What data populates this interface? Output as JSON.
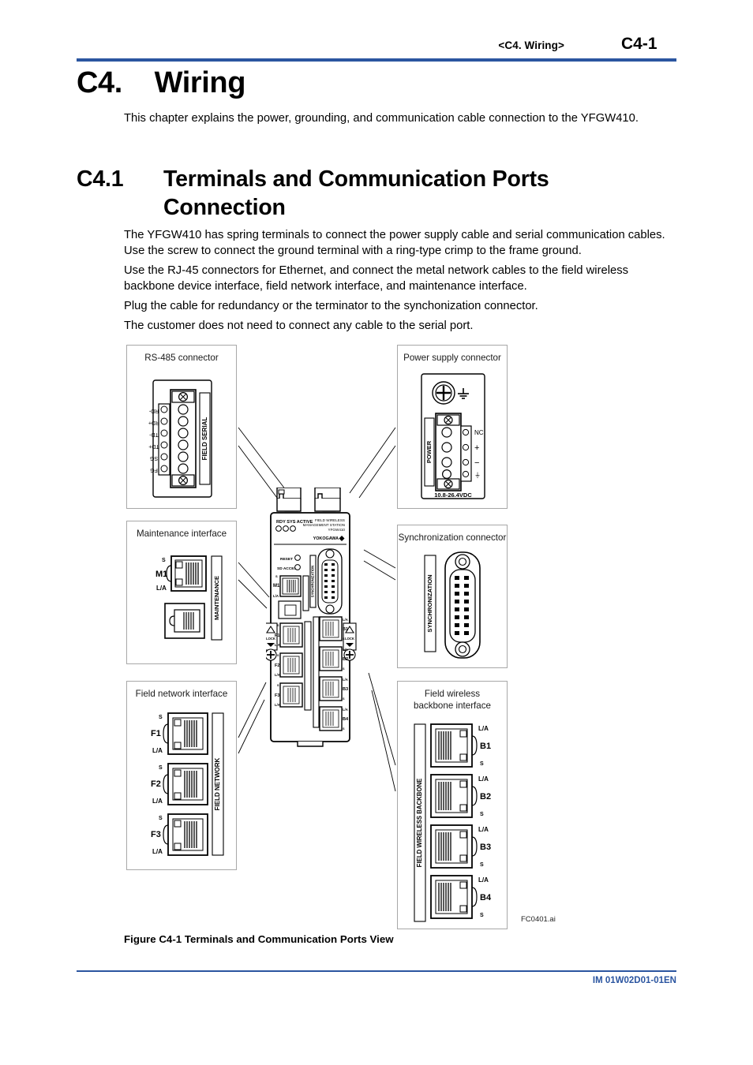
{
  "header": {
    "chapter_ref": "<C4.  Wiring>",
    "page_number": "C4-1",
    "rule_color": "#2b55a0"
  },
  "chapter": {
    "number": "C4.",
    "title": "Wiring",
    "heading_display": "C4.    Wiring",
    "intro": "This chapter explains the power, grounding, and communication cable connection to the YFGW410."
  },
  "section": {
    "number": "C4.1",
    "title": "Terminals and Communication Ports Connection",
    "paragraphs": [
      "The YFGW410 has spring terminals to connect the power supply cable and serial communication cables. Use the screw to connect the ground terminal with a ring-type crimp to the frame ground.",
      "Use the RJ-45 connectors for Ethernet, and connect the metal network cables to the field wireless backbone device interface, field network interface, and maintenance interface.",
      "Plug the cable for redundancy or the terminator to the synchonization connector.",
      "The customer does not need to connect any cable to the serial port."
    ]
  },
  "figure": {
    "caption": "Figure C4-1  Terminals and Communication Ports View",
    "artwork_ref": "FC0401.ai",
    "callouts": {
      "rs485": {
        "label": "RS-485 connector",
        "side_label": "FIELD SERIAL",
        "terminals": [
          "RD-",
          "RD+",
          "TD-",
          "TD+",
          "SG",
          "FG"
        ]
      },
      "power": {
        "label": "Power supply connector",
        "side_label": "POWER",
        "terminals": [
          "NC",
          "+",
          "−",
          "⏚"
        ],
        "voltage_rating": "10.8-26.4VDC"
      },
      "maintenance": {
        "label": "Maintenance interface",
        "side_label": "MAINTENANCE",
        "ports": [
          {
            "name": "M1",
            "led_top": "S",
            "led_bottom": "L/A"
          }
        ]
      },
      "sync": {
        "label": "Synchronization connector",
        "side_label": "SYNCHRONIZATION"
      },
      "field_network": {
        "label": "Field network interface",
        "side_label": "FIELD NETWORK",
        "ports": [
          {
            "name": "F1",
            "led_top": "S",
            "led_bottom": "L/A"
          },
          {
            "name": "F2",
            "led_top": "S",
            "led_bottom": "L/A"
          },
          {
            "name": "F3",
            "led_top": "S",
            "led_bottom": "L/A"
          }
        ]
      },
      "backbone": {
        "label_line1": "Field wireless",
        "label_line2": "backbone interface",
        "side_label": "FIELD WIRELESS BACKBONE",
        "ports": [
          {
            "name": "B1",
            "led_top": "L/A",
            "led_bottom": "S"
          },
          {
            "name": "B2",
            "led_top": "L/A",
            "led_bottom": "S"
          },
          {
            "name": "B3",
            "led_top": "L/A",
            "led_bottom": "S"
          },
          {
            "name": "B4",
            "led_top": "L/A",
            "led_bottom": "S"
          }
        ]
      }
    },
    "device": {
      "status_leds": "RDY  SYS  ACTIVE",
      "product_line1": "FIELD WIRELESS",
      "product_line2": "MANAGEMENT STATION",
      "product_model": "YFGW410",
      "brand": "YOKOGAWA",
      "indicator_labels": [
        "RESET",
        "SD ACCESS"
      ],
      "warning_label": "LOCK",
      "maintenance_port": "M1",
      "sync_side_label": "SYNCHRONIZATION",
      "left_ports": [
        "F1",
        "F2",
        "F3"
      ],
      "right_ports": [
        "B1",
        "B2",
        "B3",
        "B4"
      ],
      "led_s": "S",
      "led_la": "L/A"
    }
  },
  "footer": {
    "document_number": "IM 01W02D01-01EN",
    "color": "#2b55a0"
  }
}
